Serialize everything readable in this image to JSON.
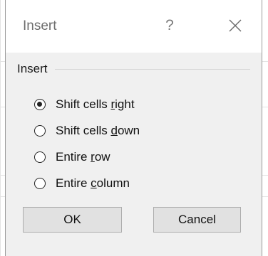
{
  "dialog": {
    "title": "Insert",
    "help_glyph": "?",
    "group_label": "Insert",
    "options": [
      {
        "pre": "Shift cells ",
        "key": "r",
        "post": "ight",
        "checked": true
      },
      {
        "pre": "Shift cells ",
        "key": "d",
        "post": "own",
        "checked": false
      },
      {
        "pre": "Entire ",
        "key": "r",
        "post": "ow",
        "checked": false
      },
      {
        "pre": "Entire ",
        "key": "c",
        "post": "olumn",
        "checked": false
      }
    ],
    "ok_label": "OK",
    "cancel_label": "Cancel"
  }
}
